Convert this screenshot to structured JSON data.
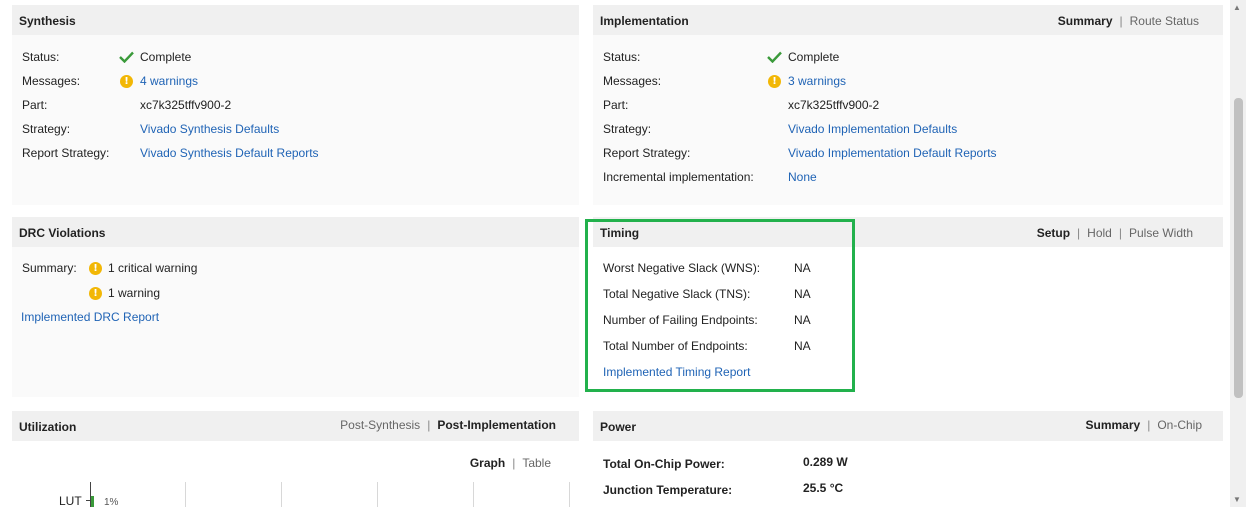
{
  "synthesis": {
    "title": "Synthesis",
    "status_label": "Status:",
    "status_value": "Complete",
    "messages_label": "Messages:",
    "messages_value": "4 warnings",
    "part_label": "Part:",
    "part_value": "xc7k325tffv900-2",
    "strategy_label": "Strategy:",
    "strategy_value": "Vivado Synthesis Defaults",
    "report_strategy_label": "Report Strategy:",
    "report_strategy_value": "Vivado Synthesis Default Reports"
  },
  "implementation": {
    "title": "Implementation",
    "tabs": [
      "Summary",
      "Route Status"
    ],
    "active_tab": "Summary",
    "status_label": "Status:",
    "status_value": "Complete",
    "messages_label": "Messages:",
    "messages_value": "3 warnings",
    "part_label": "Part:",
    "part_value": "xc7k325tffv900-2",
    "strategy_label": "Strategy:",
    "strategy_value": "Vivado Implementation Defaults",
    "report_strategy_label": "Report Strategy:",
    "report_strategy_value": "Vivado Implementation Default Reports",
    "incremental_label": "Incremental implementation:",
    "incremental_value": "None"
  },
  "drc": {
    "title": "DRC Violations",
    "summary_label": "Summary:",
    "critical_warning": "1 critical warning",
    "warning": "1 warning",
    "report_link": "Implemented DRC Report"
  },
  "timing": {
    "title": "Timing",
    "tabs": [
      "Setup",
      "Hold",
      "Pulse Width"
    ],
    "active_tab": "Setup",
    "wns_label": "Worst Negative Slack (WNS):",
    "wns_value": "NA",
    "tns_label": "Total Negative Slack (TNS):",
    "tns_value": "NA",
    "failing_label": "Number of Failing Endpoints:",
    "failing_value": "NA",
    "total_label": "Total Number of Endpoints:",
    "total_value": "NA",
    "report_link": "Implemented Timing Report"
  },
  "utilization": {
    "title": "Utilization",
    "tabs": [
      "Post-Synthesis",
      "Post-Implementation"
    ],
    "active_tab": "Post-Implementation",
    "view_tabs": [
      "Graph",
      "Table"
    ],
    "active_view": "Graph",
    "rows": [
      {
        "name": "LUT",
        "percent": "1%",
        "fraction": 0.01
      }
    ]
  },
  "power": {
    "title": "Power",
    "tabs": [
      "Summary",
      "On-Chip"
    ],
    "active_tab": "Summary",
    "total_label": "Total On-Chip Power:",
    "total_value": "0.289 W",
    "junction_label": "Junction Temperature:",
    "junction_value": "25.5 °C"
  },
  "colors": {
    "link": "#1f63b5",
    "warning": "#f2b705",
    "success": "#3a9a3a",
    "highlight": "#22b14c"
  }
}
